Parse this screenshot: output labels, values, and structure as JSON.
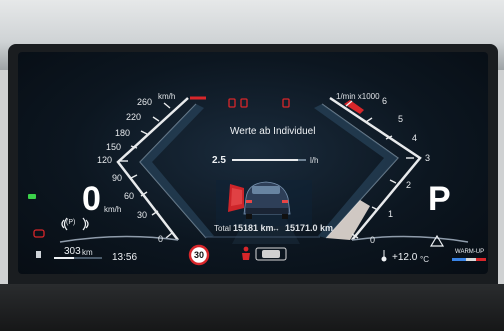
{
  "speed": {
    "unit_top": "km/h",
    "ticks": [
      "260",
      "220",
      "180",
      "150",
      "120",
      "90",
      "60",
      "30",
      "0"
    ],
    "value": "0",
    "unit_small": "km/h"
  },
  "tacho": {
    "unit_top": "1/min x1000",
    "ticks": [
      "6",
      "5",
      "4",
      "3",
      "2",
      "1",
      "0"
    ]
  },
  "center": {
    "title": "Werte ab Individuel",
    "consumption_value": "2.5",
    "consumption_unit": "l/h",
    "total_label": "Total",
    "total_value": "15181 km",
    "trip_value": "15171.0 km"
  },
  "left_info": {
    "range": "303",
    "range_unit": "km",
    "time": "13:56"
  },
  "gear": "P",
  "right_info": {
    "temperature": "+12.0",
    "temp_unit": "°C",
    "warmup": "WARM-UP"
  },
  "speed_limit": "30",
  "colors": {
    "accent_red": "#d8262a",
    "background": "#0c1620",
    "indicator_green": "#3bd14a"
  }
}
